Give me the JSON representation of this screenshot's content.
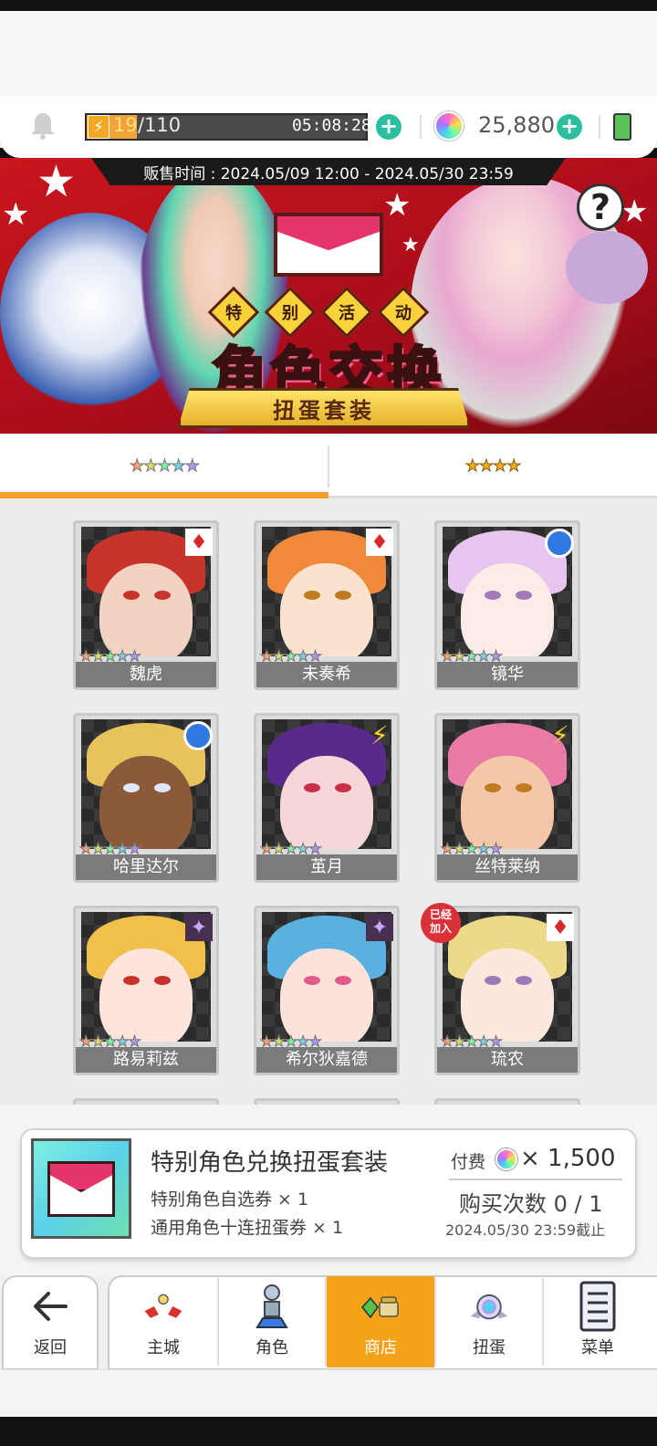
{
  "header": {
    "stamina_current": "19",
    "stamina_max": "/110",
    "stamina_timer": "05:08:28",
    "gems": "25,880"
  },
  "banner": {
    "sale_period": "贩售时间 : 2024.05/09 12:00 - 2024.05/30 23:59",
    "event_chars": [
      "特",
      "别",
      "活",
      "动"
    ],
    "title": "角色交换",
    "ribbon": "扭蛋套装",
    "help_label": "?"
  },
  "tabs": [
    {
      "label": "★★★★★",
      "active": true
    },
    {
      "label": "★★★★",
      "active": false
    }
  ],
  "characters": [
    {
      "name": "魏虎",
      "element": "fire",
      "stars": "★★★★★",
      "owned": false
    },
    {
      "name": "未奏希",
      "element": "fire",
      "stars": "★★★★★",
      "owned": false
    },
    {
      "name": "镜华",
      "element": "water",
      "stars": "★★★★★",
      "owned": false
    },
    {
      "name": "哈里达尔",
      "element": "water",
      "stars": "★★★★★",
      "owned": false
    },
    {
      "name": "茧月",
      "element": "thunder",
      "stars": "★★★★★",
      "owned": false
    },
    {
      "name": "丝特莱纳",
      "element": "thunder",
      "stars": "★★★★★",
      "owned": false
    },
    {
      "name": "路易莉兹",
      "element": "dark",
      "stars": "★★★★★",
      "owned": false
    },
    {
      "name": "希尔狄嘉德",
      "element": "dark",
      "stars": "★★★★★",
      "owned": false
    },
    {
      "name": "琉农",
      "element": "fire",
      "stars": "★★★★★",
      "owned": true
    }
  ],
  "owned_badge": "已经\n加入",
  "purchase": {
    "title": "特别角色兑换扭蛋套装",
    "item1": "特别角色自选券 × 1",
    "item2": "通用角色十连扭蛋券 × 1",
    "price_label": "付费",
    "price_value": "× 1,500",
    "buy_count": "购买次数 0 / 1",
    "deadline": "2024.05/30 23:59截止"
  },
  "nav": {
    "back": "返回",
    "items": [
      "主城",
      "角色",
      "商店",
      "扭蛋",
      "菜单"
    ],
    "active": "商店"
  },
  "colors": {
    "accent": "#f3a21a",
    "banner_red": "#c8161e",
    "plus_green": "#2bbfa0"
  }
}
